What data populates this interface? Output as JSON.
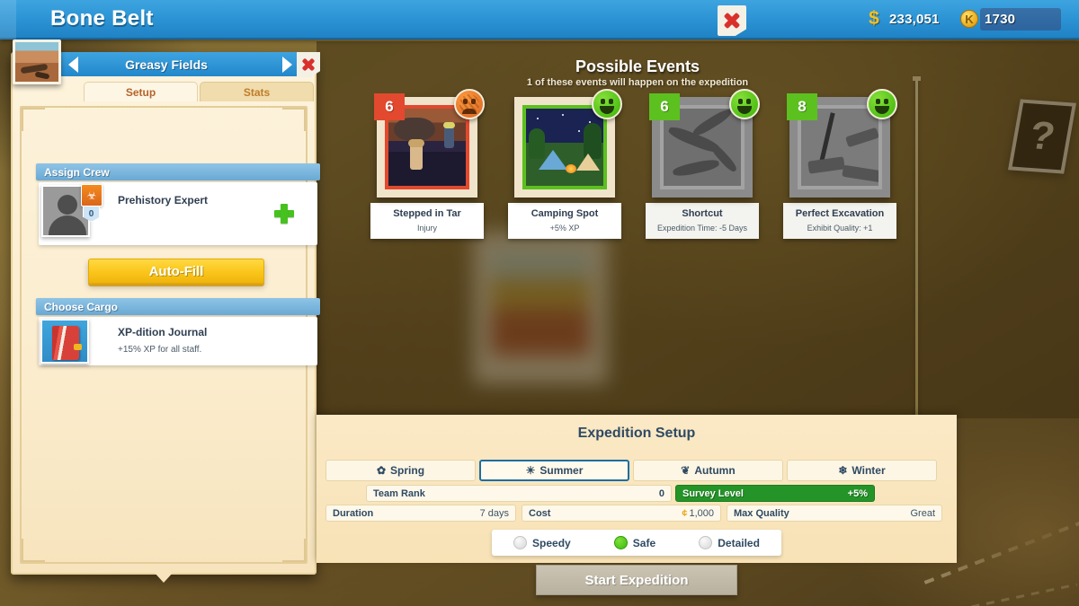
{
  "topbar": {
    "title": "Bone Belt",
    "close_icon": "close-x-icon",
    "money": {
      "icon": "money-icon",
      "symbol": "$",
      "value": "233,051"
    },
    "token": {
      "icon": "token-icon",
      "symbol": "K",
      "value": "1730"
    }
  },
  "left_panel": {
    "location": {
      "name": "Greasy Fields",
      "prev_icon": "arrow-left-icon",
      "next_icon": "arrow-right-icon",
      "close_icon": "close-x-icon",
      "thumbnail_icon": "dig-site-thumbnail"
    },
    "tabs": [
      {
        "label": "Setup",
        "active": true
      },
      {
        "label": "Stats",
        "active": false
      }
    ],
    "assign_crew": {
      "header": "Assign Crew",
      "slot": {
        "name": "Prehistory Expert",
        "level": "0",
        "skill_icon": "prehistory-skill-icon",
        "avatar_icon": "empty-avatar-icon",
        "add_icon": "plus-icon"
      },
      "auto_fill_label": "Auto-Fill"
    },
    "choose_cargo": {
      "header": "Choose Cargo",
      "item": {
        "name": "XP-dition Journal",
        "description": "+15% XP for all staff.",
        "icon": "journal-book-icon"
      }
    }
  },
  "events": {
    "title": "Possible Events",
    "subtitle": "1 of these events will happen on the expedition",
    "cards": [
      {
        "number": "6",
        "badge_color": "#e2492e",
        "show_number": true,
        "name": "Stepped in Tar",
        "effect": "Injury",
        "mood": "sad",
        "locked": false,
        "art": "tar-pit-art"
      },
      {
        "number": "",
        "badge_color": "#5cc01f",
        "show_number": false,
        "name": "Camping Spot",
        "effect": "+5% XP",
        "mood": "happy",
        "locked": false,
        "art": "campsite-art"
      },
      {
        "number": "6",
        "badge_color": "#5cc01f",
        "show_number": true,
        "name": "Shortcut",
        "effect": "Expedition Time: -5 Days",
        "mood": "happy",
        "locked": true,
        "art": "unknown-fossil-art"
      },
      {
        "number": "8",
        "badge_color": "#5cc01f",
        "show_number": true,
        "name": "Perfect Excavation",
        "effect": "Exhibit Quality: +1",
        "mood": "happy",
        "locked": true,
        "art": "unknown-dig-art"
      }
    ]
  },
  "setup": {
    "title": "Expedition Setup",
    "seasons": [
      {
        "label": "Spring",
        "icon": "flower-icon",
        "glyph": "✿",
        "selected": false
      },
      {
        "label": "Summer",
        "icon": "sun-icon",
        "glyph": "☀",
        "selected": true
      },
      {
        "label": "Autumn",
        "icon": "leaf-icon",
        "glyph": "❦",
        "selected": false
      },
      {
        "label": "Winter",
        "icon": "snowflake-icon",
        "glyph": "❄",
        "selected": false
      }
    ],
    "team_rank": {
      "label": "Team Rank",
      "value": "0"
    },
    "survey_level": {
      "label": "Survey Level",
      "value": "+5%",
      "color": "#249428"
    },
    "stats": [
      {
        "label": "Duration",
        "value": "7 days"
      },
      {
        "label": "Cost",
        "value": "1,000",
        "currency_icon": "money-icon",
        "currency_symbol": "¢"
      },
      {
        "label": "Max Quality",
        "value": "Great"
      }
    ],
    "speed_options": [
      {
        "label": "Speedy",
        "selected": false
      },
      {
        "label": "Safe",
        "selected": true
      },
      {
        "label": "Detailed",
        "selected": false
      }
    ],
    "start_button": "Start Expedition"
  },
  "background": {
    "question_card_icon": "question-mark-card-icon",
    "question_glyph": "?"
  }
}
